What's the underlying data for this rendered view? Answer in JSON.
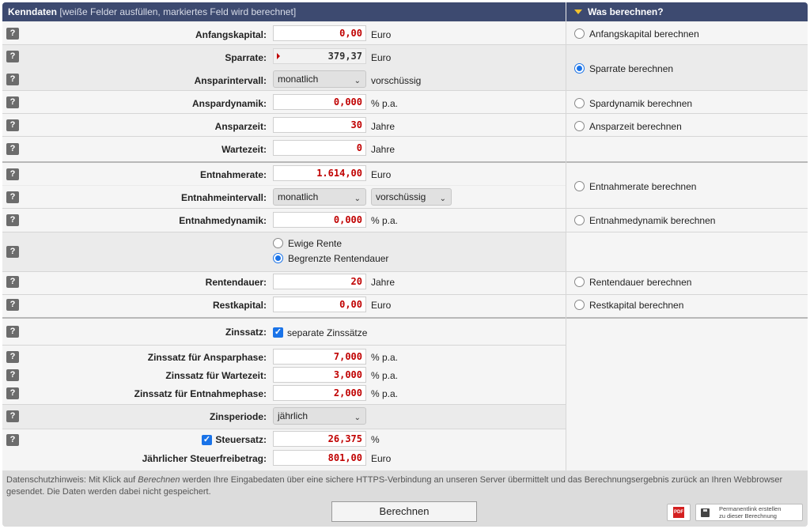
{
  "header": {
    "title": "Kenndaten",
    "subtitle": "[weiße Felder ausfüllen, markiertes Feld wird berechnet]",
    "right_title": "Was berechnen?"
  },
  "help_label": "?",
  "fields": {
    "anfangskapital": {
      "label": "Anfangskapital:",
      "value": "0,00",
      "unit": "Euro"
    },
    "sparrate": {
      "label": "Sparrate:",
      "value": "379,37",
      "unit": "Euro"
    },
    "ansparintervall": {
      "label": "Ansparintervall:",
      "value": "monatlich",
      "unit": "vorschüssig"
    },
    "anspardynamik": {
      "label": "Anspardynamik:",
      "value": "0,000",
      "unit": "% p.a."
    },
    "ansparzeit": {
      "label": "Ansparzeit:",
      "value": "30",
      "unit": "Jahre"
    },
    "wartezeit": {
      "label": "Wartezeit:",
      "value": "0",
      "unit": "Jahre"
    },
    "entnahmerate": {
      "label": "Entnahmerate:",
      "value": "1.614,00",
      "unit": "Euro"
    },
    "entnahmeintervall": {
      "label": "Entnahmeintervall:",
      "value": "monatlich",
      "timing": "vorschüssig"
    },
    "entnahmedynamik": {
      "label": "Entnahmedynamik:",
      "value": "0,000",
      "unit": "% p.a."
    },
    "rentenart": {
      "option1": "Ewige Rente",
      "option2": "Begrenzte Rentendauer",
      "selected": "Begrenzte Rentendauer"
    },
    "rentendauer": {
      "label": "Rentendauer:",
      "value": "20",
      "unit": "Jahre"
    },
    "restkapital": {
      "label": "Restkapital:",
      "value": "0,00",
      "unit": "Euro"
    },
    "zinssatz": {
      "label": "Zinssatz:",
      "checkbox_label": "separate Zinssätze",
      "checked": true
    },
    "zins_anspar": {
      "label": "Zinssatz für Ansparphase:",
      "value": "7,000",
      "unit": "% p.a."
    },
    "zins_warte": {
      "label": "Zinssatz für Wartezeit:",
      "value": "3,000",
      "unit": "% p.a."
    },
    "zins_entnahme": {
      "label": "Zinssatz für Entnahmephase:",
      "value": "2,000",
      "unit": "% p.a."
    },
    "zinsperiode": {
      "label": "Zinsperiode:",
      "value": "jährlich"
    },
    "steuersatz": {
      "label": "Steuersatz:",
      "value": "26,375",
      "unit": "%",
      "checked": true
    },
    "freibetrag": {
      "label": "Jährlicher Steuerfreibetrag:",
      "value": "801,00",
      "unit": "Euro"
    }
  },
  "calc_options": {
    "anfangskapital": "Anfangskapital berechnen",
    "sparrate": "Sparrate berechnen",
    "spardynamik": "Spardynamik berechnen",
    "ansparzeit": "Ansparzeit berechnen",
    "entnahmerate": "Entnahmerate berechnen",
    "entnahmedynamik": "Entnahmedynamik berechnen",
    "rentendauer": "Rentendauer berechnen",
    "restkapital": "Restkapital berechnen",
    "selected": "Sparrate berechnen"
  },
  "footer": {
    "privacy_prefix": "Datenschutzhinweis: Mit Klick auf ",
    "privacy_em": "Berechnen",
    "privacy_suffix": " werden Ihre Eingabedaten über eine sichere HTTPS-Verbindung an unseren Server übermittelt und das Berechnungsergebnis zurück an Ihren Webbrowser gesendet. Die Daten werden dabei nicht gespeichert.",
    "calc_button": "Berechnen",
    "pdf_label": "PDF",
    "permalink_line1": "Permanentlink erstellen",
    "permalink_line2": "zu dieser Berechnung"
  },
  "colors": {
    "header_bg": "#3d4a70",
    "value_red": "#c00000",
    "accent_blue": "#1a73e8",
    "header_triangle": "#f2c22e"
  }
}
